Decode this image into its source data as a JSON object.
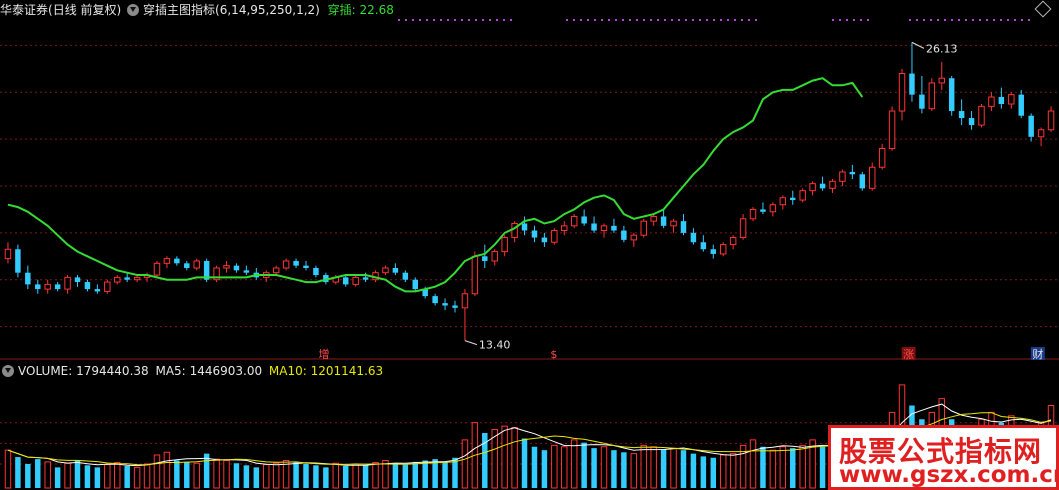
{
  "header": {
    "stock_name": "华泰证券",
    "period_label": "(日线 前复权)",
    "indicator_name": "穿插主图指标",
    "indicator_params": "(6,14,95,250,1,2)",
    "value_label": "穿插:",
    "value": "22.68"
  },
  "volume_header": {
    "volume_label": "VOLUME:",
    "volume_value": "1794440.38",
    "ma5_label": "MA5:",
    "ma5_value": "1446903.00",
    "ma10_label": "MA10:",
    "ma10_value": "1201141.63"
  },
  "markers": [
    {
      "text": "增",
      "kind": "event"
    },
    {
      "text": "$",
      "kind": "event"
    },
    {
      "text": "涨",
      "kind": "event"
    },
    {
      "text": "财",
      "kind": "event"
    }
  ],
  "colors": {
    "up": "#ff3333",
    "down": "#33ccff",
    "ma_line": "#33dd33",
    "grid": "#7a1a1a",
    "background": "#000000"
  },
  "watermark": {
    "line1": "股票公式指标网",
    "line2": "www.gszx.com.cn"
  },
  "chart_data": [
    {
      "type": "candlestick",
      "title": "华泰证券 (日线 前复权)",
      "annotations": [
        {
          "text": "26.13",
          "meaning": "high"
        },
        {
          "text": "13.40",
          "meaning": "low"
        }
      ],
      "ylim": [
        13.0,
        27.0
      ],
      "series": [
        {
          "name": "穿插",
          "values": [
            19.2,
            19.1,
            18.9,
            18.6,
            18.3,
            17.9,
            17.5,
            17.2,
            17.0,
            16.8,
            16.6,
            16.4,
            16.3,
            16.2,
            16.2,
            16.1,
            16.0,
            16.0,
            16.0,
            16.1,
            16.1,
            16.1,
            16.1,
            16.1,
            16.1,
            16.2,
            16.2,
            16.2,
            16.1,
            16.0,
            15.9,
            15.9,
            16.0,
            16.1,
            16.2,
            16.2,
            16.2,
            16.1,
            16.0,
            15.7,
            15.5,
            15.5,
            15.6,
            15.7,
            15.9,
            16.3,
            16.8,
            17.0,
            17.1,
            17.5,
            18.0,
            18.2,
            18.5,
            18.6,
            18.4,
            18.5,
            18.8,
            19.0,
            19.3,
            19.5,
            19.6,
            19.4,
            18.8,
            18.6,
            18.7,
            18.8,
            19.0,
            19.5,
            20.0,
            20.5,
            20.9,
            21.5,
            22.0,
            22.3,
            22.5,
            22.8,
            23.7,
            24.0,
            24.1,
            24.1,
            24.3,
            24.5,
            24.6,
            24.3,
            24.3,
            24.4,
            23.8
          ]
        },
        {
          "name": "OHLC",
          "values": [
            [
              16.9,
              17.6,
              16.7,
              17.3
            ],
            [
              17.3,
              17.5,
              16.1,
              16.3
            ],
            [
              16.3,
              16.6,
              15.6,
              15.8
            ],
            [
              15.8,
              16.0,
              15.4,
              15.6
            ],
            [
              15.6,
              16.0,
              15.4,
              15.8
            ],
            [
              15.8,
              15.9,
              15.5,
              15.6
            ],
            [
              15.6,
              16.2,
              15.4,
              16.1
            ],
            [
              16.1,
              16.2,
              15.7,
              15.9
            ],
            [
              15.9,
              16.0,
              15.5,
              15.6
            ],
            [
              15.6,
              15.8,
              15.4,
              15.5
            ],
            [
              15.5,
              16.0,
              15.4,
              15.9
            ],
            [
              15.9,
              16.2,
              15.8,
              16.1
            ],
            [
              16.1,
              16.3,
              15.9,
              16.0
            ],
            [
              16.0,
              16.2,
              15.9,
              16.1
            ],
            [
              16.1,
              16.3,
              15.9,
              16.2
            ],
            [
              16.2,
              16.8,
              16.1,
              16.7
            ],
            [
              16.7,
              17.0,
              16.5,
              16.9
            ],
            [
              16.9,
              17.0,
              16.6,
              16.7
            ],
            [
              16.7,
              16.8,
              16.4,
              16.5
            ],
            [
              16.5,
              16.9,
              16.4,
              16.8
            ],
            [
              16.8,
              16.9,
              15.9,
              16.0
            ],
            [
              16.0,
              16.6,
              15.9,
              16.5
            ],
            [
              16.5,
              16.8,
              16.3,
              16.6
            ],
            [
              16.6,
              16.7,
              16.3,
              16.4
            ],
            [
              16.4,
              16.6,
              16.2,
              16.3
            ],
            [
              16.3,
              16.5,
              16.0,
              16.1
            ],
            [
              16.1,
              16.4,
              15.9,
              16.3
            ],
            [
              16.3,
              16.6,
              16.2,
              16.5
            ],
            [
              16.5,
              16.9,
              16.4,
              16.8
            ],
            [
              16.8,
              16.9,
              16.5,
              16.6
            ],
            [
              16.6,
              16.8,
              16.4,
              16.5
            ],
            [
              16.5,
              16.6,
              16.1,
              16.2
            ],
            [
              16.2,
              16.3,
              15.8,
              15.9
            ],
            [
              15.9,
              16.2,
              15.8,
              16.1
            ],
            [
              16.1,
              16.2,
              15.7,
              15.8
            ],
            [
              15.8,
              16.2,
              15.7,
              16.1
            ],
            [
              16.1,
              16.3,
              15.9,
              16.0
            ],
            [
              16.0,
              16.4,
              15.9,
              16.3
            ],
            [
              16.3,
              16.6,
              16.2,
              16.5
            ],
            [
              16.5,
              16.7,
              16.2,
              16.3
            ],
            [
              16.3,
              16.4,
              15.9,
              16.0
            ],
            [
              16.0,
              16.1,
              15.5,
              15.6
            ],
            [
              15.6,
              15.7,
              15.2,
              15.3
            ],
            [
              15.3,
              15.4,
              14.9,
              15.0
            ],
            [
              15.0,
              15.2,
              14.7,
              14.9
            ],
            [
              14.9,
              15.1,
              14.6,
              14.8
            ],
            [
              14.8,
              15.6,
              13.4,
              15.4
            ],
            [
              15.4,
              17.2,
              15.3,
              17.0
            ],
            [
              17.0,
              17.5,
              16.5,
              16.8
            ],
            [
              16.8,
              17.3,
              16.6,
              17.2
            ],
            [
              17.2,
              17.9,
              17.0,
              17.8
            ],
            [
              17.8,
              18.5,
              17.6,
              18.4
            ],
            [
              18.4,
              18.7,
              17.9,
              18.1
            ],
            [
              18.1,
              18.3,
              17.6,
              17.8
            ],
            [
              17.8,
              18.0,
              17.4,
              17.6
            ],
            [
              17.6,
              18.2,
              17.5,
              18.1
            ],
            [
              18.1,
              18.5,
              17.9,
              18.3
            ],
            [
              18.3,
              18.8,
              18.2,
              18.7
            ],
            [
              18.7,
              19.0,
              18.3,
              18.4
            ],
            [
              18.4,
              18.7,
              18.0,
              18.1
            ],
            [
              18.1,
              18.4,
              17.8,
              18.3
            ],
            [
              18.3,
              18.6,
              18.0,
              18.1
            ],
            [
              18.1,
              18.3,
              17.6,
              17.7
            ],
            [
              17.7,
              18.0,
              17.4,
              17.9
            ],
            [
              17.9,
              18.6,
              17.8,
              18.5
            ],
            [
              18.5,
              18.8,
              18.3,
              18.7
            ],
            [
              18.7,
              19.0,
              18.2,
              18.3
            ],
            [
              18.3,
              18.6,
              18.0,
              18.5
            ],
            [
              18.5,
              18.8,
              17.9,
              18.0
            ],
            [
              18.0,
              18.2,
              17.5,
              17.6
            ],
            [
              17.6,
              17.9,
              17.2,
              17.3
            ],
            [
              17.3,
              17.5,
              16.9,
              17.1
            ],
            [
              17.1,
              17.6,
              17.0,
              17.5
            ],
            [
              17.5,
              17.9,
              17.3,
              17.8
            ],
            [
              17.8,
              18.8,
              17.7,
              18.6
            ],
            [
              18.6,
              19.1,
              18.5,
              19.0
            ],
            [
              19.0,
              19.3,
              18.8,
              18.9
            ],
            [
              18.9,
              19.3,
              18.7,
              19.2
            ],
            [
              19.2,
              19.6,
              19.0,
              19.5
            ],
            [
              19.5,
              19.8,
              19.2,
              19.4
            ],
            [
              19.4,
              19.9,
              19.3,
              19.8
            ],
            [
              19.8,
              20.2,
              19.6,
              20.1
            ],
            [
              20.1,
              20.4,
              19.8,
              19.9
            ],
            [
              19.9,
              20.3,
              19.7,
              20.2
            ],
            [
              20.2,
              20.7,
              20.0,
              20.6
            ],
            [
              20.6,
              20.9,
              20.3,
              20.5
            ],
            [
              20.5,
              20.6,
              19.8,
              19.9
            ],
            [
              19.9,
              21.0,
              19.8,
              20.8
            ],
            [
              20.8,
              21.8,
              20.7,
              21.6
            ],
            [
              21.6,
              23.4,
              21.5,
              23.2
            ],
            [
              23.2,
              25.0,
              22.8,
              24.8
            ],
            [
              24.8,
              26.13,
              23.6,
              23.9
            ],
            [
              23.9,
              24.7,
              23.1,
              23.3
            ],
            [
              23.3,
              24.6,
              23.2,
              24.4
            ],
            [
              24.4,
              25.3,
              24.1,
              24.6
            ],
            [
              24.6,
              24.7,
              23.0,
              23.2
            ],
            [
              23.2,
              23.7,
              22.6,
              22.9
            ],
            [
              22.9,
              23.2,
              22.4,
              22.6
            ],
            [
              22.6,
              23.5,
              22.5,
              23.4
            ],
            [
              23.4,
              24.0,
              23.2,
              23.8
            ],
            [
              23.8,
              24.2,
              23.3,
              23.5
            ],
            [
              23.5,
              24.0,
              23.3,
              23.9
            ],
            [
              23.9,
              24.1,
              22.9,
              23.0
            ],
            [
              23.0,
              23.1,
              21.9,
              22.1
            ],
            [
              22.1,
              22.5,
              21.7,
              22.4
            ],
            [
              22.4,
              23.4,
              22.3,
              23.2
            ]
          ]
        }
      ]
    },
    {
      "type": "bar",
      "title": "VOLUME",
      "series": [
        {
          "name": "VOLUME",
          "values": [
            0.55,
            0.45,
            0.35,
            0.42,
            0.38,
            0.3,
            0.36,
            0.4,
            0.33,
            0.3,
            0.34,
            0.37,
            0.32,
            0.3,
            0.35,
            0.48,
            0.52,
            0.4,
            0.38,
            0.36,
            0.5,
            0.42,
            0.4,
            0.36,
            0.33,
            0.3,
            0.34,
            0.36,
            0.4,
            0.38,
            0.35,
            0.33,
            0.3,
            0.36,
            0.32,
            0.35,
            0.33,
            0.37,
            0.4,
            0.36,
            0.34,
            0.38,
            0.4,
            0.42,
            0.38,
            0.44,
            0.7,
            0.95,
            0.8,
            0.85,
            0.9,
            0.88,
            0.72,
            0.6,
            0.55,
            0.62,
            0.6,
            0.7,
            0.66,
            0.58,
            0.6,
            0.55,
            0.52,
            0.5,
            0.62,
            0.6,
            0.56,
            0.58,
            0.55,
            0.5,
            0.46,
            0.44,
            0.48,
            0.5,
            0.62,
            0.7,
            0.6,
            0.55,
            0.6,
            0.58,
            0.62,
            0.7,
            0.6,
            0.58,
            0.65,
            0.62,
            0.55,
            0.75,
            0.85,
            1.1,
            1.5,
            1.2,
            1.0,
            1.1,
            1.3,
            1.0,
            0.9,
            0.85,
            1.0,
            1.1,
            0.95,
            1.05,
            0.9,
            0.85,
            0.95,
            1.2
          ]
        },
        {
          "name": "MA5",
          "values": []
        },
        {
          "name": "MA10",
          "values": []
        }
      ]
    }
  ]
}
